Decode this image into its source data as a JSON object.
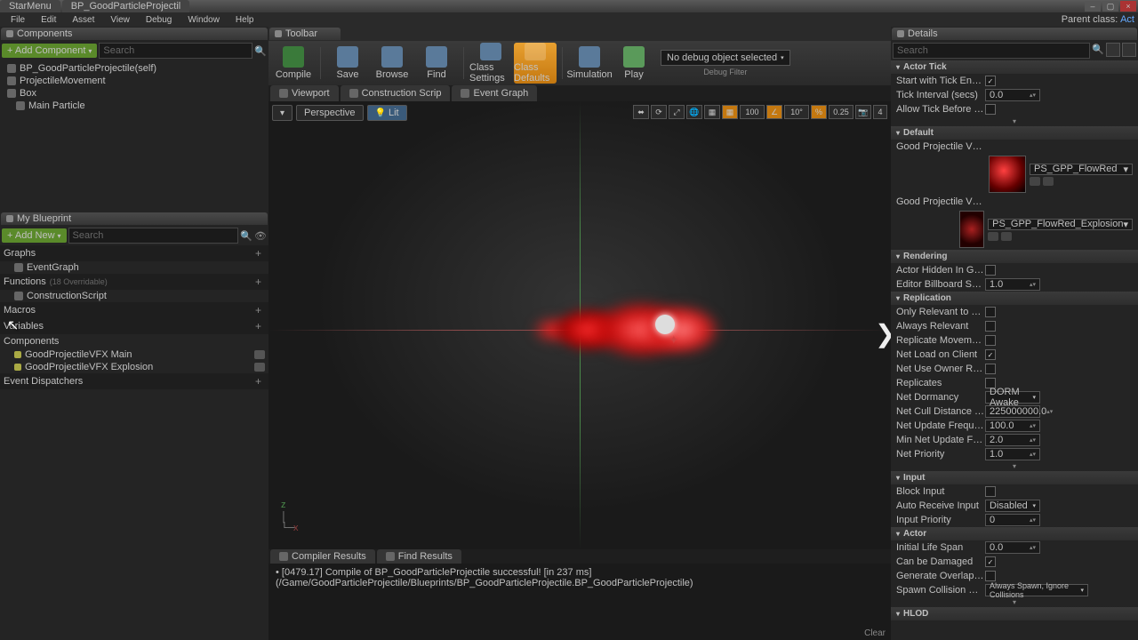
{
  "title_tabs": [
    "StarMenu",
    "BP_GoodParticleProjectil"
  ],
  "menu": [
    "File",
    "Edit",
    "Asset",
    "View",
    "Debug",
    "Window",
    "Help"
  ],
  "parent_class_label": "Parent class:",
  "parent_class_value": "Act",
  "components": {
    "panel": "Components",
    "add": "+ Add Component",
    "search_placeholder": "Search",
    "items": [
      "BP_GoodParticleProjectile(self)",
      "ProjectileMovement",
      "Box",
      "Main Particle"
    ]
  },
  "myblueprint": {
    "panel": "My Blueprint",
    "add": "+ Add New",
    "search_placeholder": "Search",
    "graphs": "Graphs",
    "eventgraph": "EventGraph",
    "functions": "Functions",
    "overridable": "(18 Overridable)",
    "constructionscript": "ConstructionScript",
    "macros": "Macros",
    "variables": "Variables",
    "components_cat": "Components",
    "var1": "GoodProjectileVFX Main",
    "var2": "GoodProjectileVFX Explosion",
    "dispatchers": "Event Dispatchers"
  },
  "toolbar": {
    "panel": "Toolbar",
    "compile": "Compile",
    "save": "Save",
    "browse": "Browse",
    "find": "Find",
    "class_settings": "Class Settings",
    "class_defaults": "Class Defaults",
    "simulation": "Simulation",
    "play": "Play",
    "no_debug": "No debug object selected",
    "debug_filter": "Debug Filter"
  },
  "editor_tabs": [
    "Viewport",
    "Construction Scrip",
    "Event Graph"
  ],
  "viewport": {
    "perspective": "Perspective",
    "lit": "Lit",
    "snap1": "100",
    "snap2": "10°",
    "snap3": "0.25",
    "snap4": "4"
  },
  "results": {
    "tab1": "Compiler Results",
    "tab2": "Find Results",
    "line": "[0479.17] Compile of BP_GoodParticleProjectile successful! [in 237 ms] (/Game/GoodParticleProjectile/Blueprints/BP_GoodParticleProjectile.BP_GoodParticleProjectile)",
    "clear": "Clear"
  },
  "details": {
    "panel": "Details",
    "search_placeholder": "Search",
    "actor_tick": "Actor Tick",
    "start_tick": "Start with Tick Enabled",
    "tick_interval": "Tick Interval (secs)",
    "tick_interval_v": "0.0",
    "allow_tick": "Allow Tick Before Begin Pla",
    "default": "Default",
    "vfx_main_label": "Good Projectile VFX Main",
    "vfx_main_val": "PS_GPP_FlowRed",
    "vfx_expl_label": "Good Projectile VFX Explosi",
    "vfx_expl_val": "PS_GPP_FlowRed_Explosion",
    "rendering": "Rendering",
    "hidden": "Actor Hidden In Game",
    "billboard": "Editor Billboard Scale",
    "billboard_v": "1.0",
    "replication": "Replication",
    "only_rel": "Only Relevant to Owner",
    "always_rel": "Always Relevant",
    "rep_move": "Replicate Movement",
    "net_load": "Net Load on Client",
    "net_use": "Net Use Owner Relevancy",
    "replicates": "Replicates",
    "dormancy": "Net Dormancy",
    "dormancy_v": "DORM Awake",
    "cull": "Net Cull Distance Squared",
    "cull_v": "225000000.0",
    "upd_freq": "Net Update Frequency",
    "upd_freq_v": "100.0",
    "min_upd": "Min Net Update Frequency",
    "min_upd_v": "2.0",
    "priority": "Net Priority",
    "priority_v": "1.0",
    "input": "Input",
    "block": "Block Input",
    "auto_rec": "Auto Receive Input",
    "auto_rec_v": "Disabled",
    "inp_pri": "Input Priority",
    "inp_pri_v": "0",
    "actor": "Actor",
    "lifespan": "Initial Life Span",
    "lifespan_v": "0.0",
    "damaged": "Can be Damaged",
    "overlap": "Generate Overlap Events Du",
    "spawn_coll": "Spawn Collision Handling M",
    "spawn_coll_v": "Always Spawn, Ignore Collisions",
    "hlod": "HLOD"
  }
}
